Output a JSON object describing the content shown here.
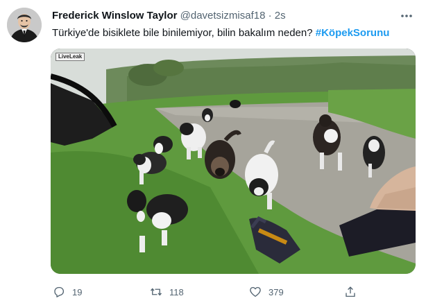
{
  "tweet": {
    "author_name": "Frederick Winslow Taylor",
    "handle": "@davetsizmisaf18",
    "separator": "·",
    "time": "2s",
    "text": "Türkiye'de bisiklete bile binilemiyor, bilin bakalım neden?",
    "hashtag": "#KöpekSorunu",
    "media_watermark": "LiveLeak"
  },
  "actions": {
    "reply_count": "19",
    "retweet_count": "118",
    "like_count": "379"
  },
  "icons": {
    "more": "more-horizontal-icon",
    "reply": "reply-icon",
    "retweet": "retweet-icon",
    "like": "heart-icon",
    "share": "share-icon"
  },
  "colors": {
    "text": "#0f1419",
    "secondary": "#536471",
    "accent": "#1d9bf0"
  }
}
